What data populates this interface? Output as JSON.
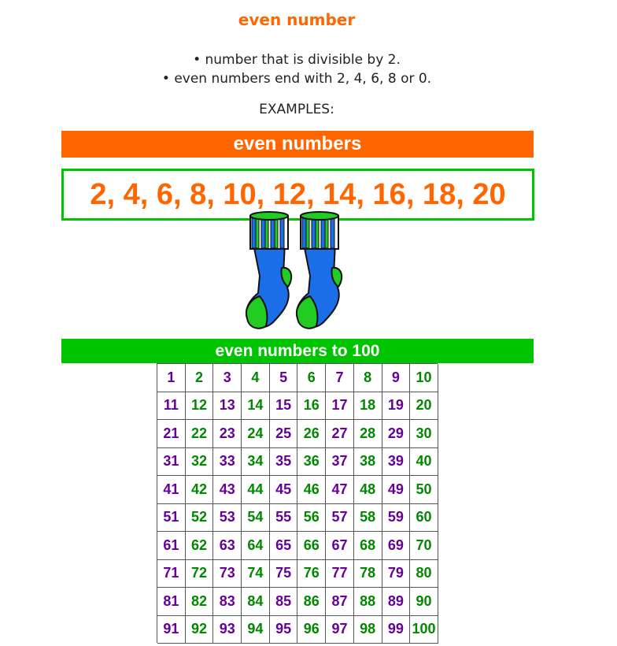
{
  "title": "even number",
  "definitions": [
    "• number that is divisible by 2.",
    "• even numbers end with 2, 4, 6, 8 or 0."
  ],
  "examples_label": "EXAMPLES:",
  "even_banner": "even numbers",
  "even_list": "2, 4, 6, 8, 10, 12, 14, 16, 18, 20",
  "hundred_banner": "even numbers to 100",
  "grid": {
    "numbers": [
      1,
      2,
      3,
      4,
      5,
      6,
      7,
      8,
      9,
      10,
      11,
      12,
      13,
      14,
      15,
      16,
      17,
      18,
      19,
      20,
      21,
      22,
      23,
      24,
      25,
      26,
      27,
      28,
      29,
      30,
      31,
      32,
      33,
      34,
      35,
      36,
      37,
      38,
      39,
      40,
      41,
      42,
      43,
      44,
      45,
      46,
      47,
      48,
      49,
      50,
      51,
      52,
      53,
      54,
      55,
      56,
      57,
      58,
      59,
      60,
      61,
      62,
      63,
      64,
      65,
      66,
      67,
      68,
      69,
      70,
      71,
      72,
      73,
      74,
      75,
      76,
      77,
      78,
      79,
      80,
      81,
      82,
      83,
      84,
      85,
      86,
      87,
      88,
      89,
      90,
      91,
      92,
      93,
      94,
      95,
      96,
      97,
      98,
      99,
      100
    ],
    "odd_color": "#660099",
    "even_color": "#008800"
  },
  "colors": {
    "orange": "#ff6600",
    "green": "#00c400",
    "sock_blue": "#1a6fe8",
    "sock_green": "#22cc22"
  },
  "image": {
    "icon": "socks-icon"
  }
}
